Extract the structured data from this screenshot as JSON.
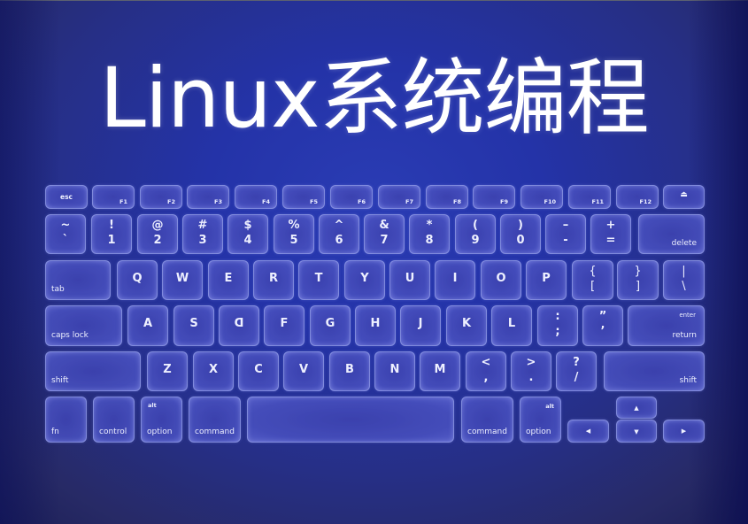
{
  "title": "Linux系统编程",
  "colors": {
    "background": "#2433a8",
    "key_fill": "#3c42af",
    "key_border": "#afb9f5",
    "text": "#ffffff"
  },
  "keyboard": {
    "function_row": {
      "esc": "esc",
      "f_keys": [
        "F1",
        "F2",
        "F3",
        "F4",
        "F5",
        "F6",
        "F7",
        "F8",
        "F9",
        "F10",
        "F11",
        "F12"
      ],
      "eject": "⏏"
    },
    "number_row": {
      "keys": [
        {
          "top": "~",
          "bottom": "`"
        },
        {
          "top": "!",
          "bottom": "1"
        },
        {
          "top": "@",
          "bottom": "2"
        },
        {
          "top": "#",
          "bottom": "3"
        },
        {
          "top": "$",
          "bottom": "4"
        },
        {
          "top": "%",
          "bottom": "5"
        },
        {
          "top": "^",
          "bottom": "6"
        },
        {
          "top": "&",
          "bottom": "7"
        },
        {
          "top": "*",
          "bottom": "8"
        },
        {
          "top": "(",
          "bottom": "9"
        },
        {
          "top": ")",
          "bottom": "0"
        },
        {
          "top": "–",
          "bottom": "-"
        },
        {
          "top": "+",
          "bottom": "="
        }
      ],
      "delete": "delete"
    },
    "qwerty_row": {
      "tab": "tab",
      "letters": [
        "Q",
        "W",
        "E",
        "R",
        "T",
        "Y",
        "U",
        "I",
        "O",
        "P"
      ],
      "brackets": [
        {
          "top": "{",
          "bottom": "["
        },
        {
          "top": "}",
          "bottom": "]"
        },
        {
          "top": "|",
          "bottom": "\\"
        }
      ]
    },
    "home_row": {
      "caps_lock": "caps lock",
      "letters": [
        "A",
        "S",
        "ᗡ",
        "F",
        "G",
        "H",
        "J",
        "K",
        "L"
      ],
      "punct": [
        {
          "top": ":",
          "bottom": ";"
        },
        {
          "top": "”",
          "bottom": "’"
        }
      ],
      "enter": "enter",
      "return": "return"
    },
    "shift_row": {
      "left_shift": "shift",
      "letters": [
        "Z",
        "X",
        "C",
        "V",
        "B",
        "N",
        "M"
      ],
      "punct": [
        {
          "top": "<",
          "bottom": ","
        },
        {
          "top": ">",
          "bottom": "."
        },
        {
          "top": "?",
          "bottom": "/"
        }
      ],
      "right_shift": "shift"
    },
    "bottom_row": {
      "fn": "fn",
      "control": "control",
      "left_alt": "alt",
      "left_option": "option",
      "left_command": "command",
      "space": "",
      "right_command": "command",
      "right_alt": "alt",
      "right_option": "option",
      "arrow_up": "▲",
      "arrow_left": "◀",
      "arrow_down": "▼",
      "arrow_right": "▶"
    }
  }
}
